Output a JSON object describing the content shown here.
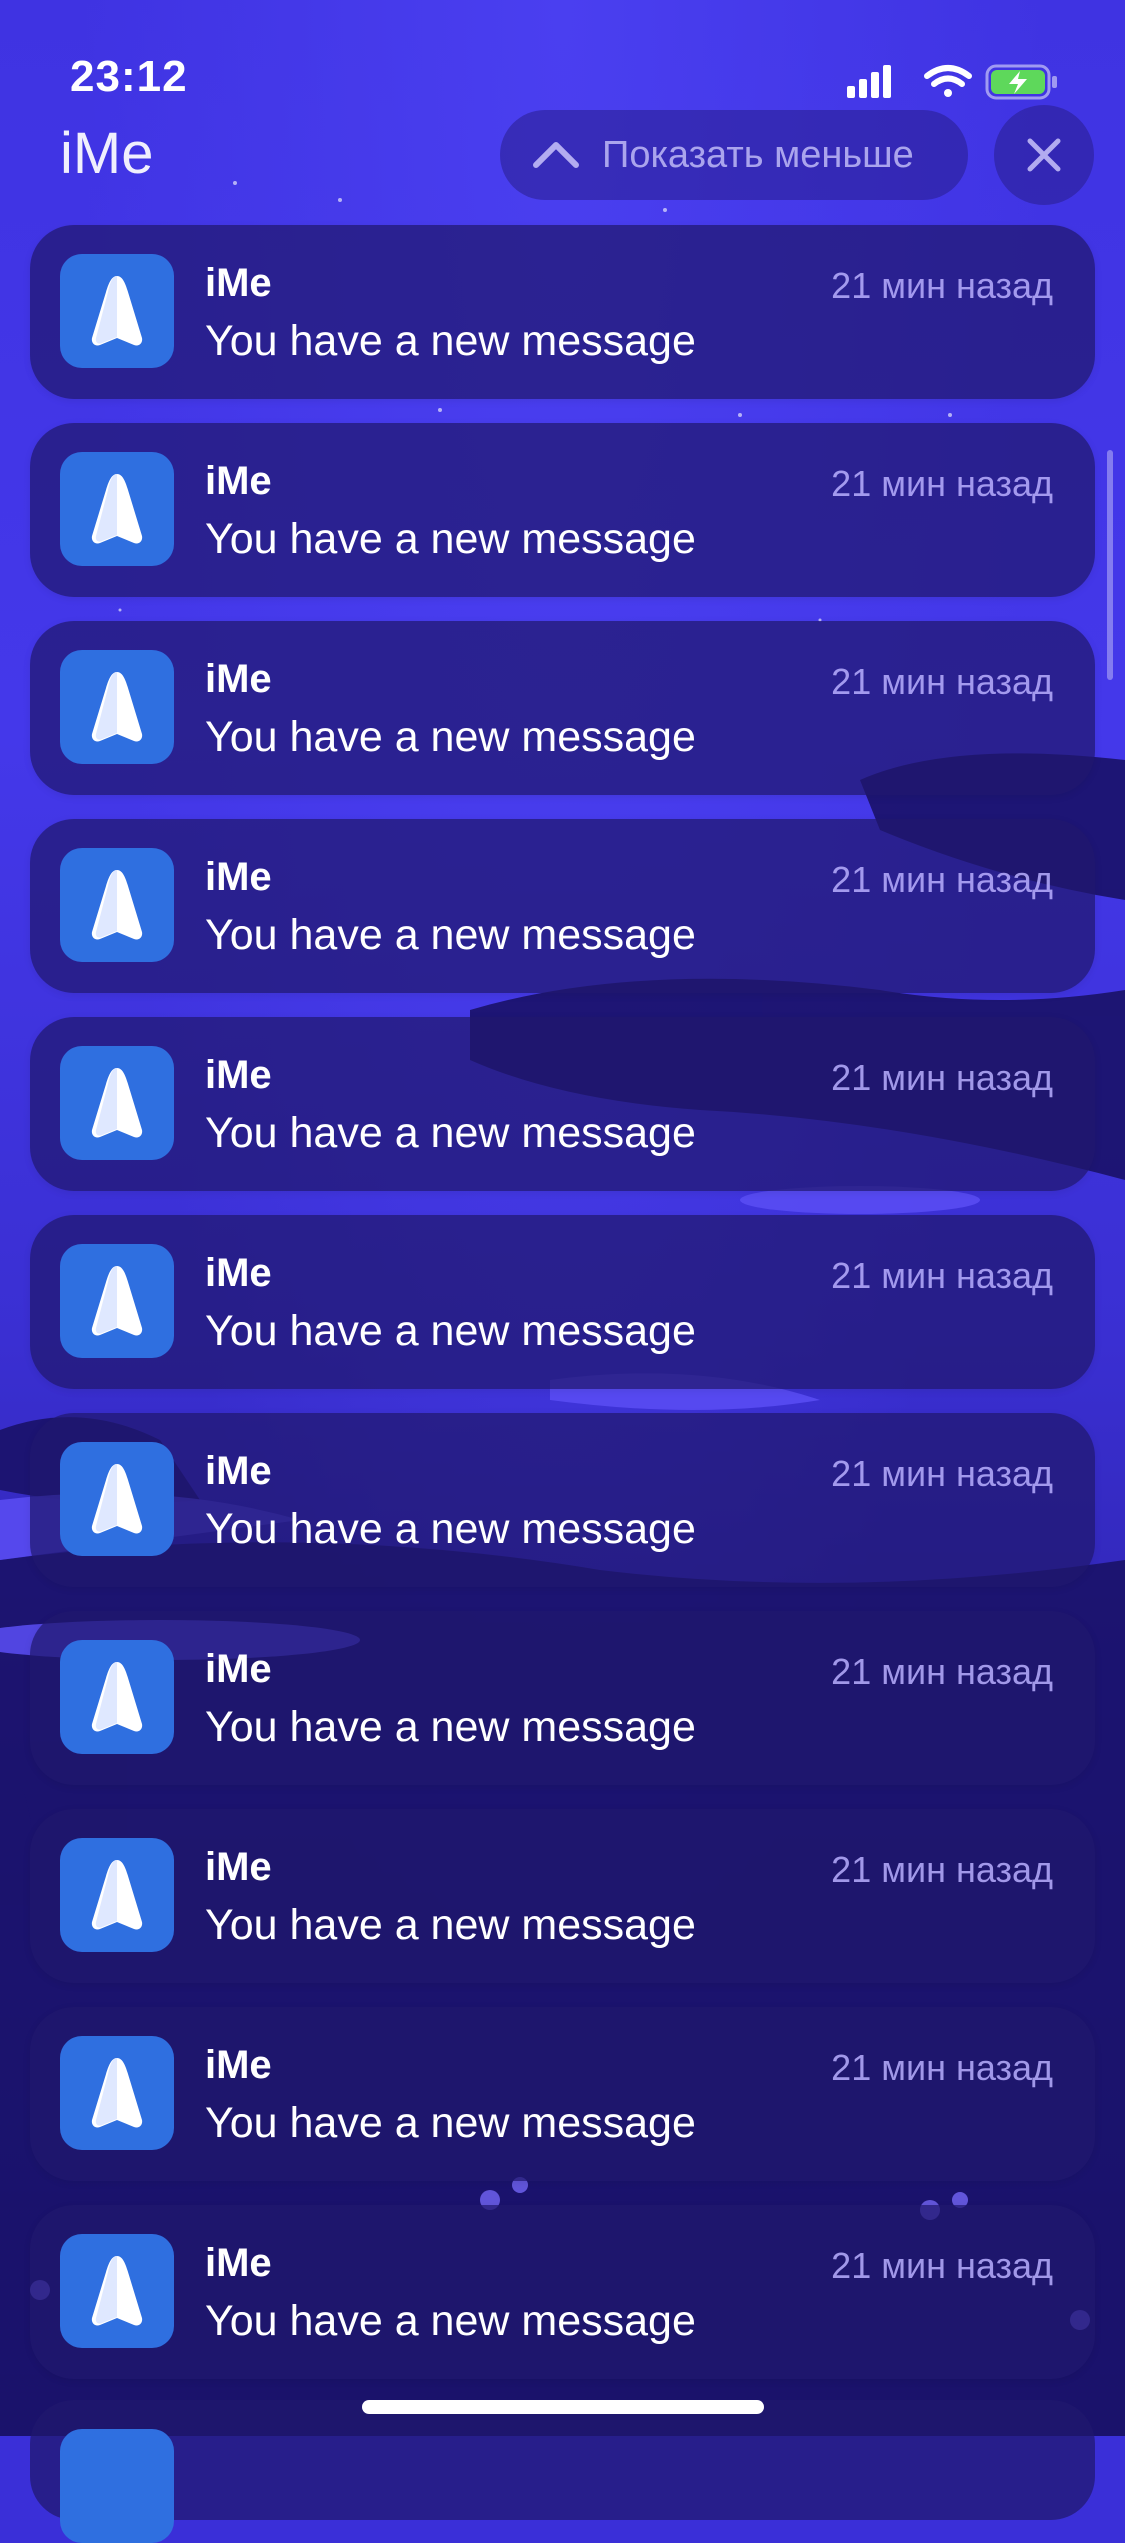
{
  "status_bar": {
    "time": "23:12",
    "icons": [
      "cellular-signal-icon",
      "wifi-icon",
      "battery-charging-icon"
    ]
  },
  "group": {
    "title": "iMe",
    "show_less_label": "Показать меньше",
    "close_icon": "close-icon"
  },
  "notifications": [
    {
      "app": "iMe",
      "time": "21 мин назад",
      "message": "You have a new message"
    },
    {
      "app": "iMe",
      "time": "21 мин назад",
      "message": "You have a new message"
    },
    {
      "app": "iMe",
      "time": "21 мин назад",
      "message": "You have a new message"
    },
    {
      "app": "iMe",
      "time": "21 мин назад",
      "message": "You have a new message"
    },
    {
      "app": "iMe",
      "time": "21 мин назад",
      "message": "You have a new message"
    },
    {
      "app": "iMe",
      "time": "21 мин назад",
      "message": "You have a new message"
    },
    {
      "app": "iMe",
      "time": "21 мин назад",
      "message": "You have a new message"
    },
    {
      "app": "iMe",
      "time": "21 мин назад",
      "message": "You have a new message"
    },
    {
      "app": "iMe",
      "time": "21 мин назад",
      "message": "You have a new message"
    },
    {
      "app": "iMe",
      "time": "21 мин назад",
      "message": "You have a new message"
    },
    {
      "app": "iMe",
      "time": "21 мин назад",
      "message": "You have a new message"
    }
  ],
  "colors": {
    "wallpaper": "#3f33e2",
    "card": "#20186e",
    "app_icon": "#2f6fe0",
    "time_ago": "#b9afff",
    "battery": "#5ed85b"
  }
}
